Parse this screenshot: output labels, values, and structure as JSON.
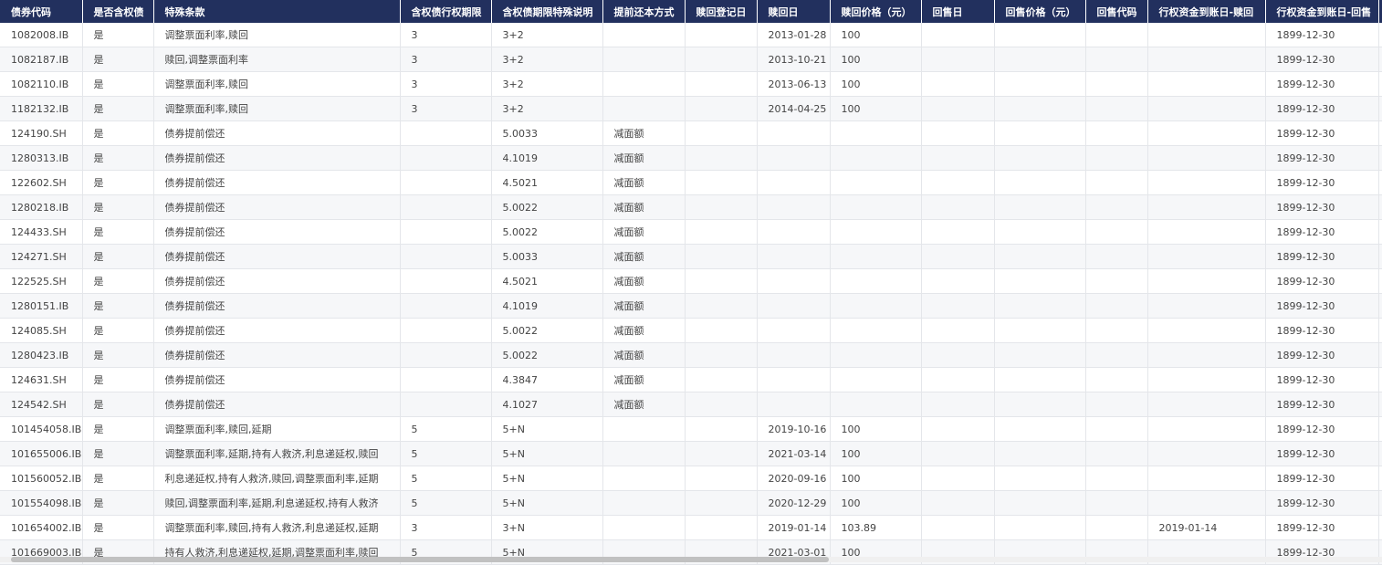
{
  "colors": {
    "header_bg": "#22305e",
    "header_text": "#ffffff",
    "row_alt": "#f6f7f9"
  },
  "columns": [
    "债券代码",
    "是否含权债",
    "特殊条款",
    "含权债行权期限",
    "含权债期限特殊说明",
    "提前还本方式",
    "赎回登记日",
    "赎回日",
    "赎回价格（元）",
    "回售日",
    "回售价格（元）",
    "回售代码",
    "行权资金到账日-赎回",
    "行权资金到账日-回售",
    ""
  ],
  "rows": [
    [
      "1082008.IB",
      "是",
      "调整票面利率,赎回",
      "3",
      "3+2",
      "",
      "",
      "2013-01-28",
      "100",
      "",
      "",
      "",
      "",
      "1899-12-30",
      ""
    ],
    [
      "1082187.IB",
      "是",
      "赎回,调整票面利率",
      "3",
      "3+2",
      "",
      "",
      "2013-10-21",
      "100",
      "",
      "",
      "",
      "",
      "1899-12-30",
      ""
    ],
    [
      "1082110.IB",
      "是",
      "调整票面利率,赎回",
      "3",
      "3+2",
      "",
      "",
      "2013-06-13",
      "100",
      "",
      "",
      "",
      "",
      "1899-12-30",
      ""
    ],
    [
      "1182132.IB",
      "是",
      "调整票面利率,赎回",
      "3",
      "3+2",
      "",
      "",
      "2014-04-25",
      "100",
      "",
      "",
      "",
      "",
      "1899-12-30",
      ""
    ],
    [
      "124190.SH",
      "是",
      "债券提前偿还",
      "",
      "5.0033",
      "减面额",
      "",
      "",
      "",
      "",
      "",
      "",
      "",
      "1899-12-30",
      ""
    ],
    [
      "1280313.IB",
      "是",
      "债券提前偿还",
      "",
      "4.1019",
      "减面额",
      "",
      "",
      "",
      "",
      "",
      "",
      "",
      "1899-12-30",
      ""
    ],
    [
      "122602.SH",
      "是",
      "债券提前偿还",
      "",
      "4.5021",
      "减面额",
      "",
      "",
      "",
      "",
      "",
      "",
      "",
      "1899-12-30",
      ""
    ],
    [
      "1280218.IB",
      "是",
      "债券提前偿还",
      "",
      "5.0022",
      "减面额",
      "",
      "",
      "",
      "",
      "",
      "",
      "",
      "1899-12-30",
      ""
    ],
    [
      "124433.SH",
      "是",
      "债券提前偿还",
      "",
      "5.0022",
      "减面额",
      "",
      "",
      "",
      "",
      "",
      "",
      "",
      "1899-12-30",
      ""
    ],
    [
      "124271.SH",
      "是",
      "债券提前偿还",
      "",
      "5.0033",
      "减面额",
      "",
      "",
      "",
      "",
      "",
      "",
      "",
      "1899-12-30",
      ""
    ],
    [
      "122525.SH",
      "是",
      "债券提前偿还",
      "",
      "4.5021",
      "减面额",
      "",
      "",
      "",
      "",
      "",
      "",
      "",
      "1899-12-30",
      ""
    ],
    [
      "1280151.IB",
      "是",
      "债券提前偿还",
      "",
      "4.1019",
      "减面额",
      "",
      "",
      "",
      "",
      "",
      "",
      "",
      "1899-12-30",
      ""
    ],
    [
      "124085.SH",
      "是",
      "债券提前偿还",
      "",
      "5.0022",
      "减面额",
      "",
      "",
      "",
      "",
      "",
      "",
      "",
      "1899-12-30",
      ""
    ],
    [
      "1280423.IB",
      "是",
      "债券提前偿还",
      "",
      "5.0022",
      "减面额",
      "",
      "",
      "",
      "",
      "",
      "",
      "",
      "1899-12-30",
      ""
    ],
    [
      "124631.SH",
      "是",
      "债券提前偿还",
      "",
      "4.3847",
      "减面额",
      "",
      "",
      "",
      "",
      "",
      "",
      "",
      "1899-12-30",
      ""
    ],
    [
      "124542.SH",
      "是",
      "债券提前偿还",
      "",
      "4.1027",
      "减面额",
      "",
      "",
      "",
      "",
      "",
      "",
      "",
      "1899-12-30",
      ""
    ],
    [
      "101454058.IB",
      "是",
      "调整票面利率,赎回,延期",
      "5",
      "5+N",
      "",
      "",
      "2019-10-16",
      "100",
      "",
      "",
      "",
      "",
      "1899-12-30",
      ""
    ],
    [
      "101655006.IB",
      "是",
      "调整票面利率,延期,持有人救济,利息递延权,赎回",
      "5",
      "5+N",
      "",
      "",
      "2021-03-14",
      "100",
      "",
      "",
      "",
      "",
      "1899-12-30",
      ""
    ],
    [
      "101560052.IB",
      "是",
      "利息递延权,持有人救济,赎回,调整票面利率,延期",
      "5",
      "5+N",
      "",
      "",
      "2020-09-16",
      "100",
      "",
      "",
      "",
      "",
      "1899-12-30",
      ""
    ],
    [
      "101554098.IB",
      "是",
      "赎回,调整票面利率,延期,利息递延权,持有人救济",
      "5",
      "5+N",
      "",
      "",
      "2020-12-29",
      "100",
      "",
      "",
      "",
      "",
      "1899-12-30",
      ""
    ],
    [
      "101654002.IB",
      "是",
      "调整票面利率,赎回,持有人救济,利息递延权,延期",
      "3",
      "3+N",
      "",
      "",
      "2019-01-14",
      "103.89",
      "",
      "",
      "",
      "2019-01-14",
      "1899-12-30",
      ""
    ],
    [
      "101669003.IB",
      "是",
      "持有人救济,利息递延权,延期,调整票面利率,赎回",
      "5",
      "5+N",
      "",
      "",
      "2021-03-01",
      "100",
      "",
      "",
      "",
      "",
      "1899-12-30",
      ""
    ]
  ]
}
